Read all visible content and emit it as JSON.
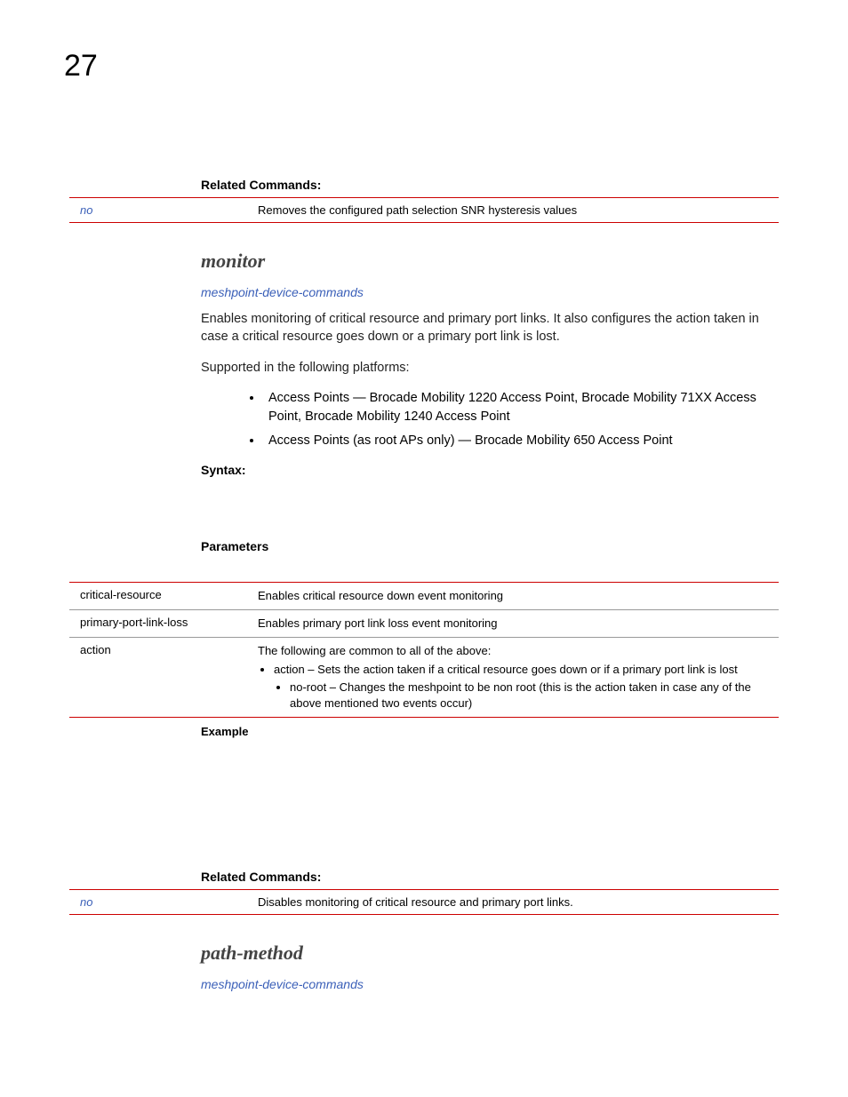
{
  "pageNumber": "27",
  "section1": {
    "relatedHeading": "Related Commands:",
    "row": {
      "key": "no",
      "desc": "Removes the configured path selection SNR hysteresis values"
    }
  },
  "monitor": {
    "title": "monitor",
    "link": "meshpoint-device-commands",
    "para1": "Enables monitoring of critical resource and primary port links. It also configures the action taken in case a critical resource goes down or a primary port link is lost.",
    "para2": "Supported in the following platforms:",
    "bullets": [
      "Access Points — Brocade Mobility 1220 Access Point, Brocade Mobility 71XX Access Point, Brocade Mobility 1240 Access Point",
      "Access Points (as root APs only) — Brocade Mobility 650 Access Point"
    ],
    "syntaxHeading": "Syntax:",
    "paramsHeading": "Parameters",
    "paramRows": [
      {
        "key": "critical-resource",
        "desc": "Enables critical resource down event monitoring"
      },
      {
        "key": "primary-port-link-loss",
        "desc": "Enables primary port link loss event monitoring"
      }
    ],
    "paramRow3": {
      "key": "action",
      "line1": "The following are common to all of the above:",
      "b1": "action – Sets the action taken if a critical resource goes down or if a primary port link is lost",
      "b2": "no-root – Changes the meshpoint to be non root (this is the action taken in case any of the above mentioned two events occur)"
    },
    "exampleHeading": "Example",
    "relatedHeading": "Related Commands:",
    "relatedRow": {
      "key": "no",
      "desc": "Disables monitoring of critical resource and primary port links."
    }
  },
  "pathMethod": {
    "title": "path-method",
    "link": "meshpoint-device-commands"
  }
}
